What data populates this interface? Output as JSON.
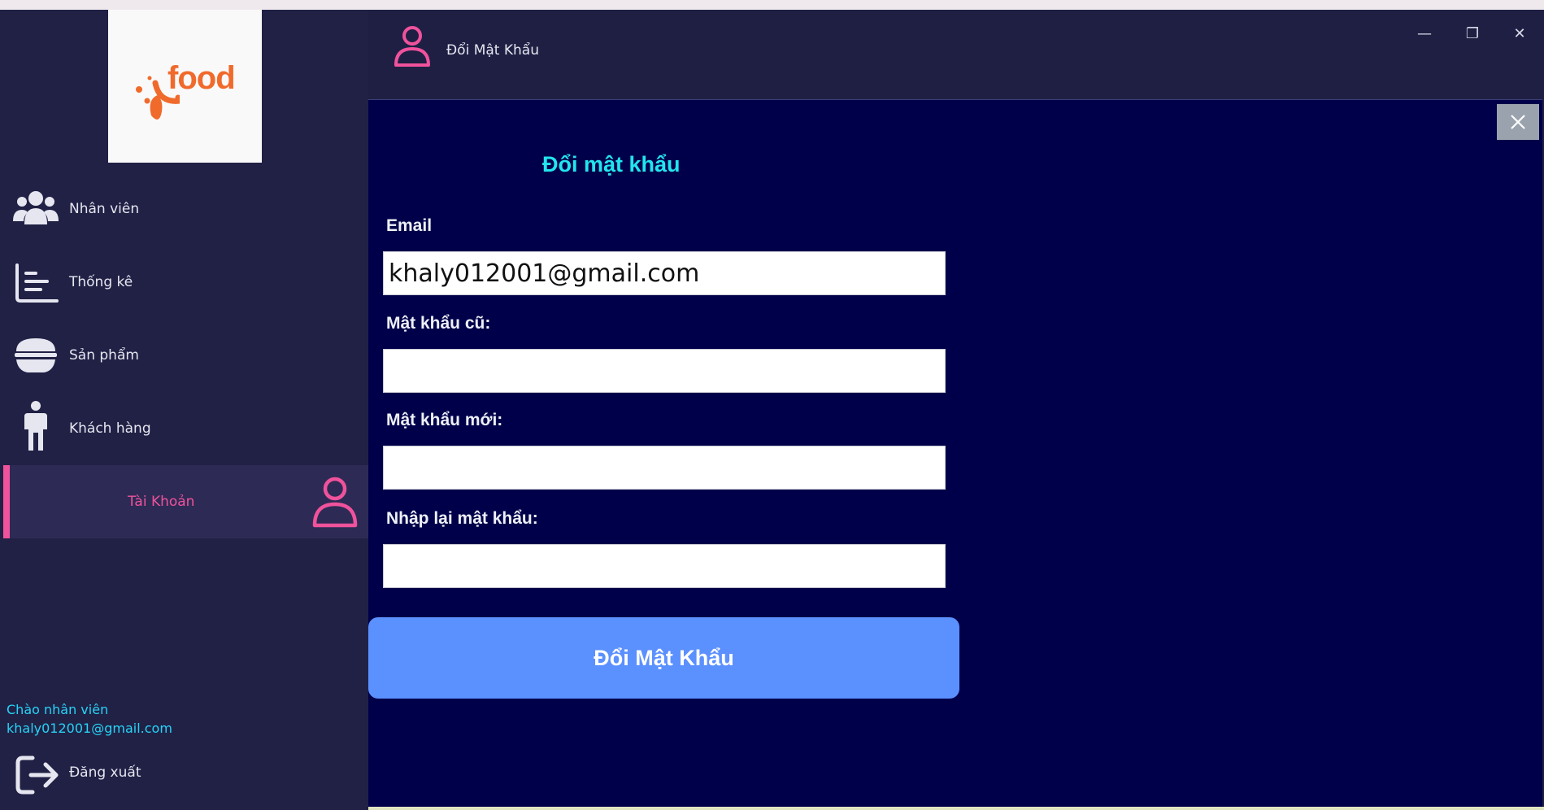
{
  "app": {
    "logo_text": "food",
    "colors": {
      "accent_pink": "#f0529c",
      "accent_cyan": "#22e5ee",
      "button_blue": "#5b90ff",
      "panel_bg": "#00004a",
      "sidebar_bg": "#212146",
      "logo_orange": "#f06a2c"
    }
  },
  "sidebar": {
    "items": [
      {
        "label": "Nhân viên",
        "icon": "users-group-icon"
      },
      {
        "label": "Thống kê",
        "icon": "chart-list-icon"
      },
      {
        "label": "Sản phẩm",
        "icon": "food-bowl-icon"
      },
      {
        "label": "Khách hàng",
        "icon": "person-icon"
      },
      {
        "label": "Tài Khoản",
        "icon": "user-account-icon",
        "active": true
      }
    ],
    "greeting_line1": "Chào nhân viên",
    "greeting_line2": "khaly012001@gmail.com",
    "logout_label": "Đăng xuất"
  },
  "header": {
    "title": "Đổi Mật Khẩu",
    "icon": "user-account-icon",
    "window_controls": {
      "minimize": "—",
      "restore": "❐",
      "close": "✕"
    }
  },
  "form": {
    "title": "Đổi mật khẩu",
    "email_label": "Email",
    "email_value": "khaly012001@gmail.com",
    "old_password_label": "Mật khẩu cũ:",
    "old_password_value": "",
    "new_password_label": "Mật khẩu mới:",
    "new_password_value": "",
    "confirm_password_label": "Nhập lại mật khẩu:",
    "confirm_password_value": "",
    "submit_label": "Đổi Mật Khẩu"
  }
}
